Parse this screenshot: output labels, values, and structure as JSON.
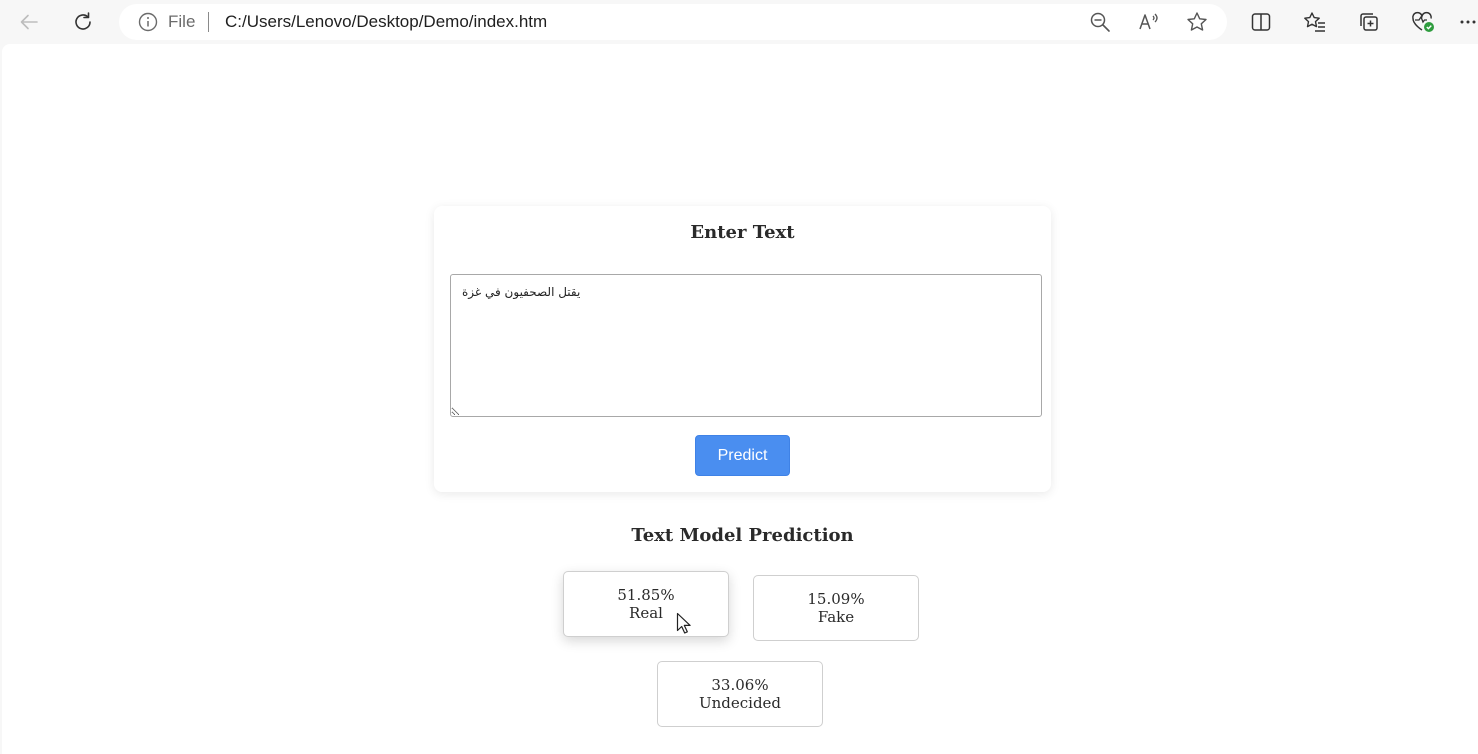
{
  "browser": {
    "address_info_label": "File",
    "url": "C:/Users/Lenovo/Desktop/Demo/index.htm",
    "icons": [
      "back-icon",
      "refresh-icon",
      "info-icon",
      "zoom-out-icon",
      "read-aloud-icon",
      "favorite-star-icon",
      "split-screen-icon",
      "favorites-icon",
      "collections-icon",
      "browser-essentials-icon",
      "more-icon"
    ],
    "accent_green": "#2e9c3e"
  },
  "input_card": {
    "title": "Enter Text",
    "textarea_value": "يقتل الصحفيون في غزة",
    "predict_label": "Predict",
    "button_color": "#4a8ef0"
  },
  "results": {
    "title": "Text Model Prediction",
    "items": [
      {
        "percent": "51.85%",
        "label": "Real"
      },
      {
        "percent": "15.09%",
        "label": "Fake"
      },
      {
        "percent": "33.06%",
        "label": "Undecided"
      }
    ]
  }
}
